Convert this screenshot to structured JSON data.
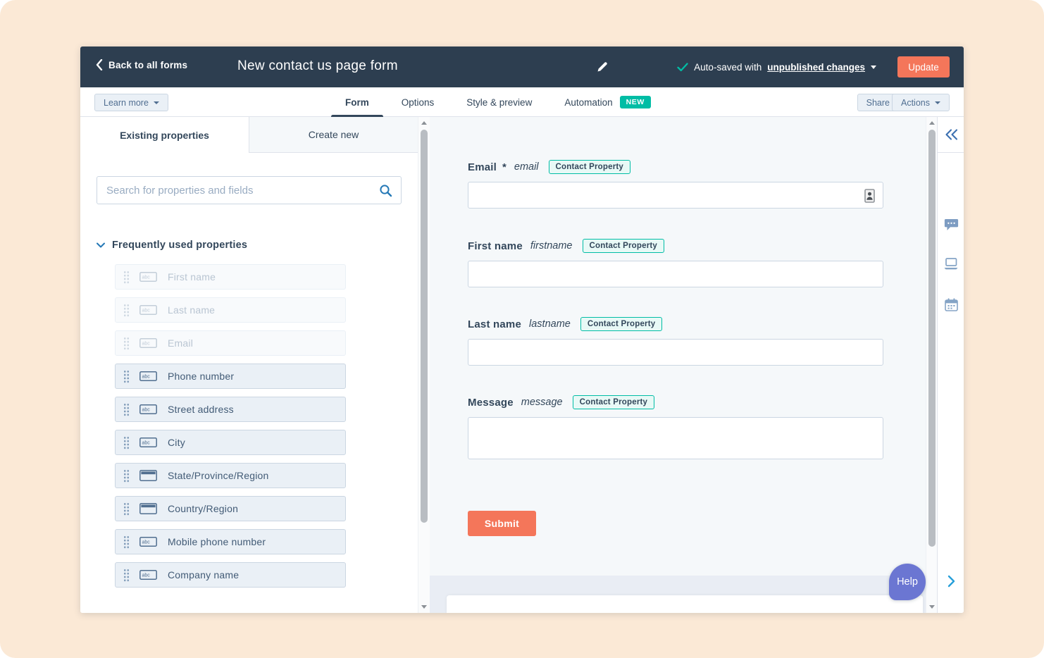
{
  "topbar": {
    "back_label": "Back to all forms",
    "title": "New contact us page form",
    "autosave_prefix": "Auto-saved with",
    "autosave_link": "unpublished changes",
    "update_label": "Update"
  },
  "toolbar": {
    "learn_more_label": "Learn more",
    "tabs": [
      {
        "label": "Form",
        "active": true
      },
      {
        "label": "Options",
        "active": false
      },
      {
        "label": "Style & preview",
        "active": false
      },
      {
        "label": "Automation",
        "active": false,
        "badge": "NEW"
      }
    ],
    "share_label": "Share",
    "actions_label": "Actions"
  },
  "left_panel": {
    "tab_existing": "Existing properties",
    "tab_create": "Create new",
    "search_placeholder": "Search for properties and fields",
    "section_title": "Frequently used properties",
    "items": [
      {
        "label": "First name",
        "type": "text",
        "disabled": true
      },
      {
        "label": "Last name",
        "type": "text",
        "disabled": true
      },
      {
        "label": "Email",
        "type": "text",
        "disabled": true
      },
      {
        "label": "Phone number",
        "type": "text",
        "disabled": false
      },
      {
        "label": "Street address",
        "type": "text",
        "disabled": false
      },
      {
        "label": "City",
        "type": "text",
        "disabled": false
      },
      {
        "label": "State/Province/Region",
        "type": "select",
        "disabled": false
      },
      {
        "label": "Country/Region",
        "type": "select",
        "disabled": false
      },
      {
        "label": "Mobile phone number",
        "type": "text",
        "disabled": false
      },
      {
        "label": "Company name",
        "type": "text",
        "disabled": false
      }
    ]
  },
  "form_preview": {
    "fields": [
      {
        "label": "Email",
        "required_mark": "*",
        "internal_name": "email",
        "badge": "Contact Property",
        "kind": "input"
      },
      {
        "label": "First name",
        "internal_name": "firstname",
        "badge": "Contact Property",
        "kind": "input"
      },
      {
        "label": "Last name",
        "internal_name": "lastname",
        "badge": "Contact Property",
        "kind": "input"
      },
      {
        "label": "Message",
        "internal_name": "message",
        "badge": "Contact Property",
        "kind": "textarea"
      }
    ],
    "submit_label": "Submit"
  },
  "right_rail": {
    "help_label": "Help"
  },
  "icons": {
    "text_field_glyph": "abc"
  },
  "colors": {
    "navbar": "#2d3e50",
    "accent_orange": "#f4765a",
    "teal": "#00bda5",
    "text_dark": "#33475b",
    "muted_blue": "#7c98b6",
    "border": "#cbd6e2",
    "item_bg": "#eaf0f6",
    "main_bg": "#f5f8fa",
    "help_purple": "#6b76d2",
    "desktop_peach": "#fbe9d6"
  }
}
